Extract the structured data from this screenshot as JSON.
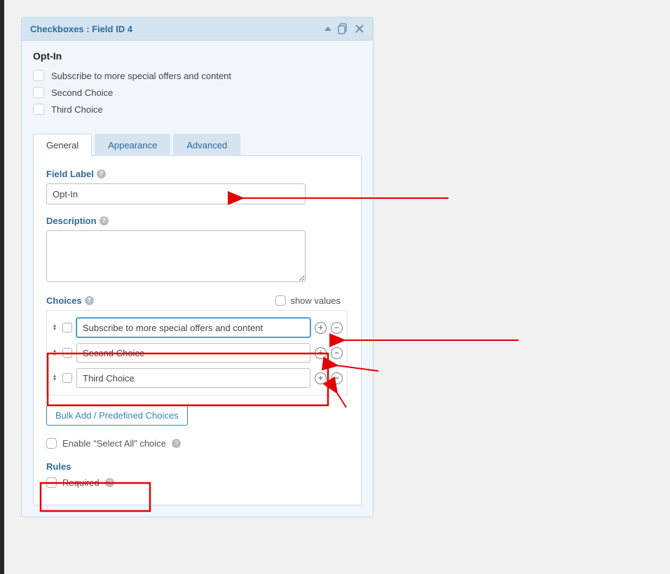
{
  "panel": {
    "title": "Checkboxes : Field ID 4"
  },
  "preview": {
    "label": "Opt-In",
    "items": [
      "Subscribe to more special offers and content",
      "Second Choice",
      "Third Choice"
    ]
  },
  "tabs": {
    "general": "General",
    "appearance": "Appearance",
    "advanced": "Advanced"
  },
  "form": {
    "field_label_title": "Field Label",
    "field_label_value": "Opt-In",
    "description_title": "Description",
    "choices_title": "Choices",
    "show_values_label": "show values",
    "choices": [
      "Subscribe to more special offers and content",
      "Second Choice",
      "Third Choice"
    ],
    "bulk_add_label": "Bulk Add / Predefined Choices",
    "select_all_label": "Enable \"Select All\" choice",
    "rules_title": "Rules",
    "required_label": "Required"
  },
  "help_icon": "?"
}
